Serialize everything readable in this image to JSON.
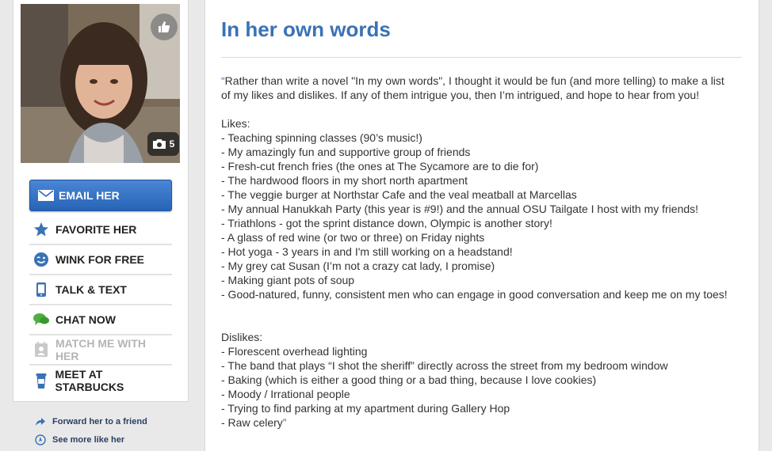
{
  "profile": {
    "photo_count": "5"
  },
  "actions": {
    "email_label": "EMAIL HER",
    "items": [
      {
        "label": "FAVORITE HER",
        "icon": "star-icon"
      },
      {
        "label": "WINK FOR FREE",
        "icon": "wink-icon"
      },
      {
        "label": "TALK & TEXT",
        "icon": "phone-icon"
      },
      {
        "label": "CHAT NOW",
        "icon": "chat-icon"
      },
      {
        "label": "MATCH ME WITH HER",
        "icon": "match-icon",
        "disabled": true
      },
      {
        "label": "MEET AT STARBUCKS",
        "icon": "cup-icon"
      }
    ]
  },
  "side_links": [
    {
      "label": "Forward her to a friend",
      "icon": "forward-arrow-icon"
    },
    {
      "label": "See more like her",
      "icon": "compass-icon"
    }
  ],
  "section": {
    "title": "In her own words",
    "intro_lines": [
      "Rather than write a novel \"In my own words\", I thought it would be fun (and more telling) to make a list",
      "of my likes and dislikes. If any of them intrigue you, then I’m intrigued, and hope to hear from you!"
    ],
    "likes_heading": "Likes:",
    "likes": [
      "- Teaching spinning classes (90’s music!)",
      "- My amazingly fun and supportive group of friends",
      "- Fresh-cut french fries (the ones at The Sycamore are to die for)",
      "- The hardwood floors in my short north apartment",
      "- The veggie burger at Northstar Cafe and the veal meatball at Marcellas",
      "- My annual Hanukkah Party (this year is #9!) and the annual OSU Tailgate I host with my friends!",
      "- Triathlons - got the sprint distance down, Olympic is another story!",
      "- A glass of red wine (or two or three) on Friday nights",
      "- Hot yoga - 3 years in and I'm still working on a headstand!",
      "- My grey cat Susan (I’m not a crazy cat lady, I promise)",
      "- Making giant pots of soup",
      "- Good-natured, funny, consistent men who can engage in good conversation and keep me on my toes!"
    ],
    "dislikes_heading": "Dislikes:",
    "dislikes": [
      "- Florescent overhead lighting",
      "- The band that plays “I shot the sheriff” directly across the street from my bedroom window",
      "- Baking (which is either a good thing or a bad thing, because I love cookies)",
      "- Moody / Irrational people",
      "- Trying to find parking at my apartment during Gallery Hop",
      "- Raw celery"
    ],
    "open_quote": "“",
    "close_quote": "”"
  }
}
